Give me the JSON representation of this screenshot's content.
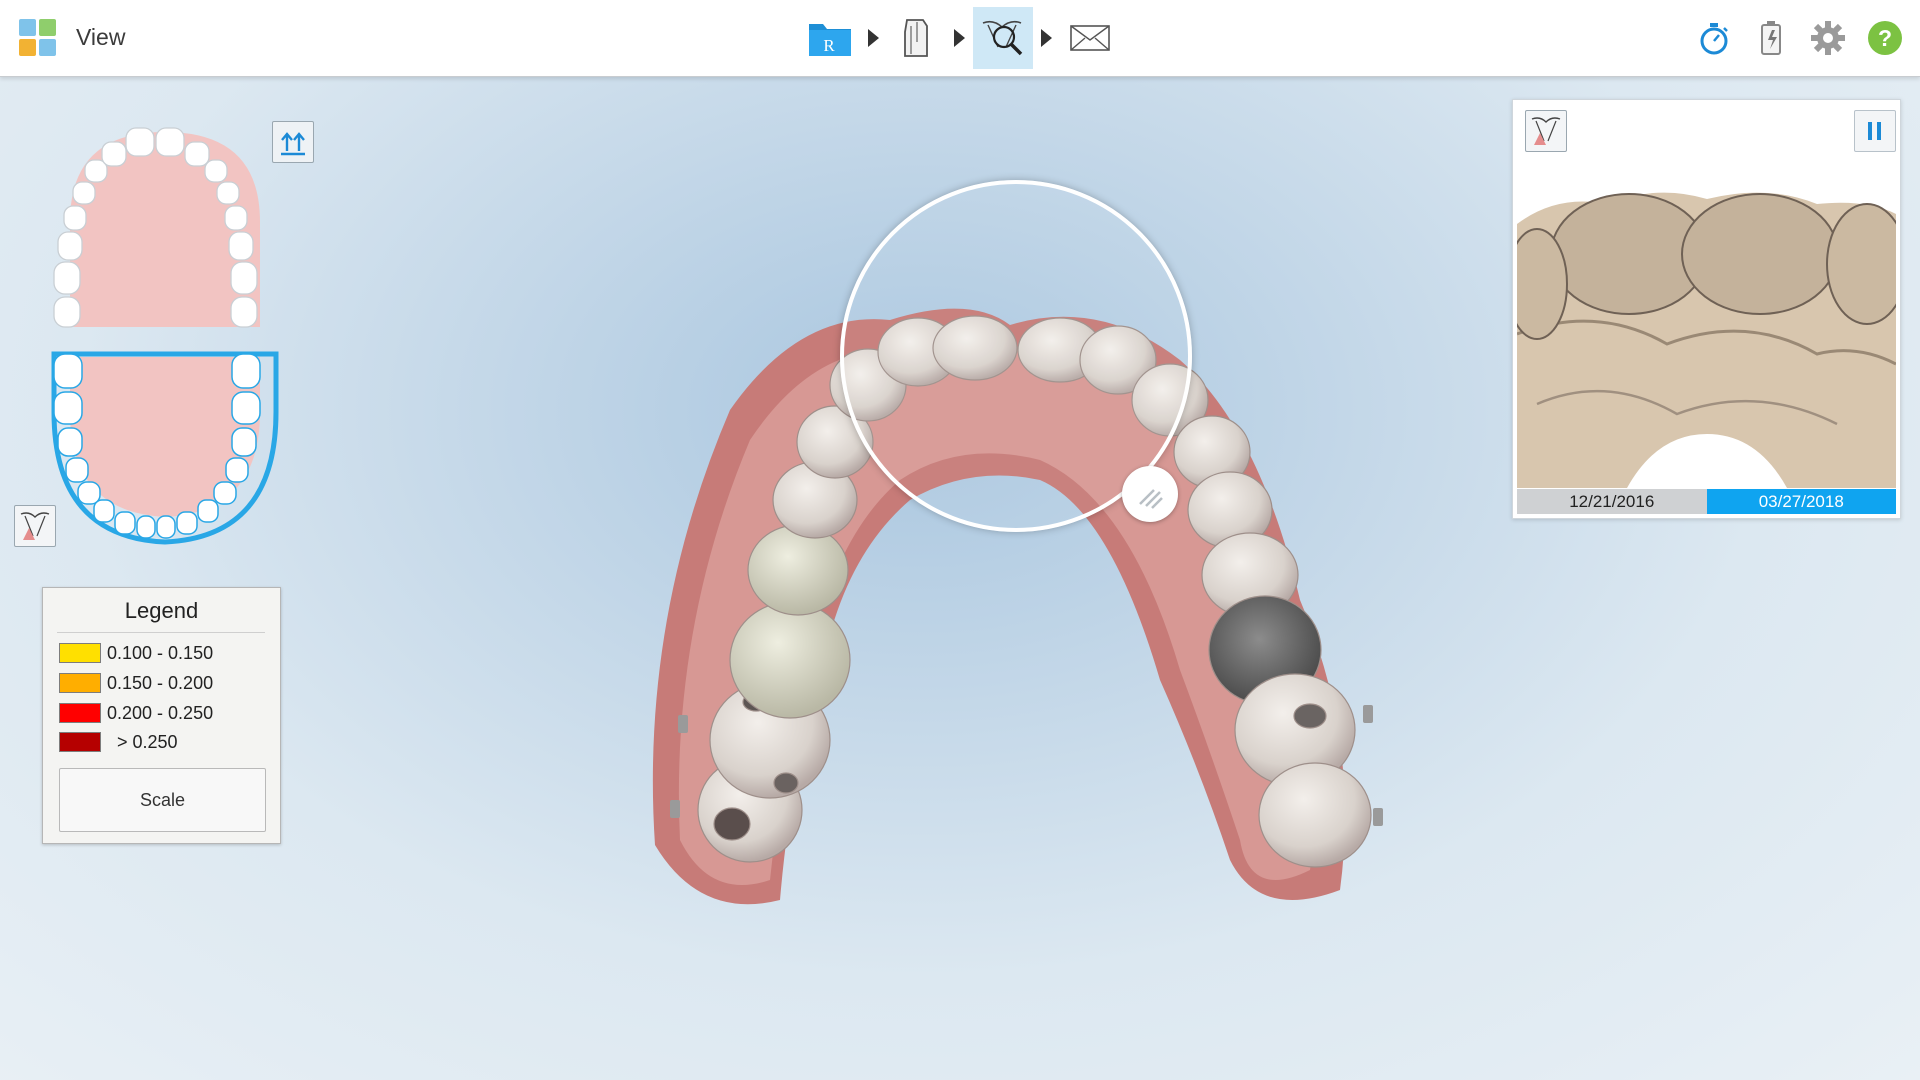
{
  "header": {
    "title": "View",
    "workflow_steps": [
      "rx-step",
      "scan-step",
      "view-step",
      "send-step"
    ],
    "active_step": "view-step",
    "right_icons": [
      "stopwatch-icon",
      "battery-icon",
      "settings-gear-icon",
      "help-icon"
    ]
  },
  "jaw_selector": {
    "selected_jaw": "lower",
    "upper_teeth": 16,
    "lower_teeth": 16
  },
  "legend": {
    "title": "Legend",
    "items": [
      {
        "label": "0.100 - 0.150",
        "color": "#ffe000"
      },
      {
        "label": "0.150 - 0.200",
        "color": "#ffae00"
      },
      {
        "label": "0.200 - 0.250",
        "color": "#ff0000"
      },
      {
        "label": "  > 0.250",
        "color": "#b50000"
      }
    ],
    "scale_button": "Scale"
  },
  "compare_panel": {
    "date_old": "12/21/2016",
    "date_new": "03/27/2018",
    "active_date": "03/27/2018"
  },
  "colors": {
    "accent": "#0fa4f0",
    "jaw_outline_selected": "#29a7e6",
    "gum_pink": "#f2c4c2"
  }
}
